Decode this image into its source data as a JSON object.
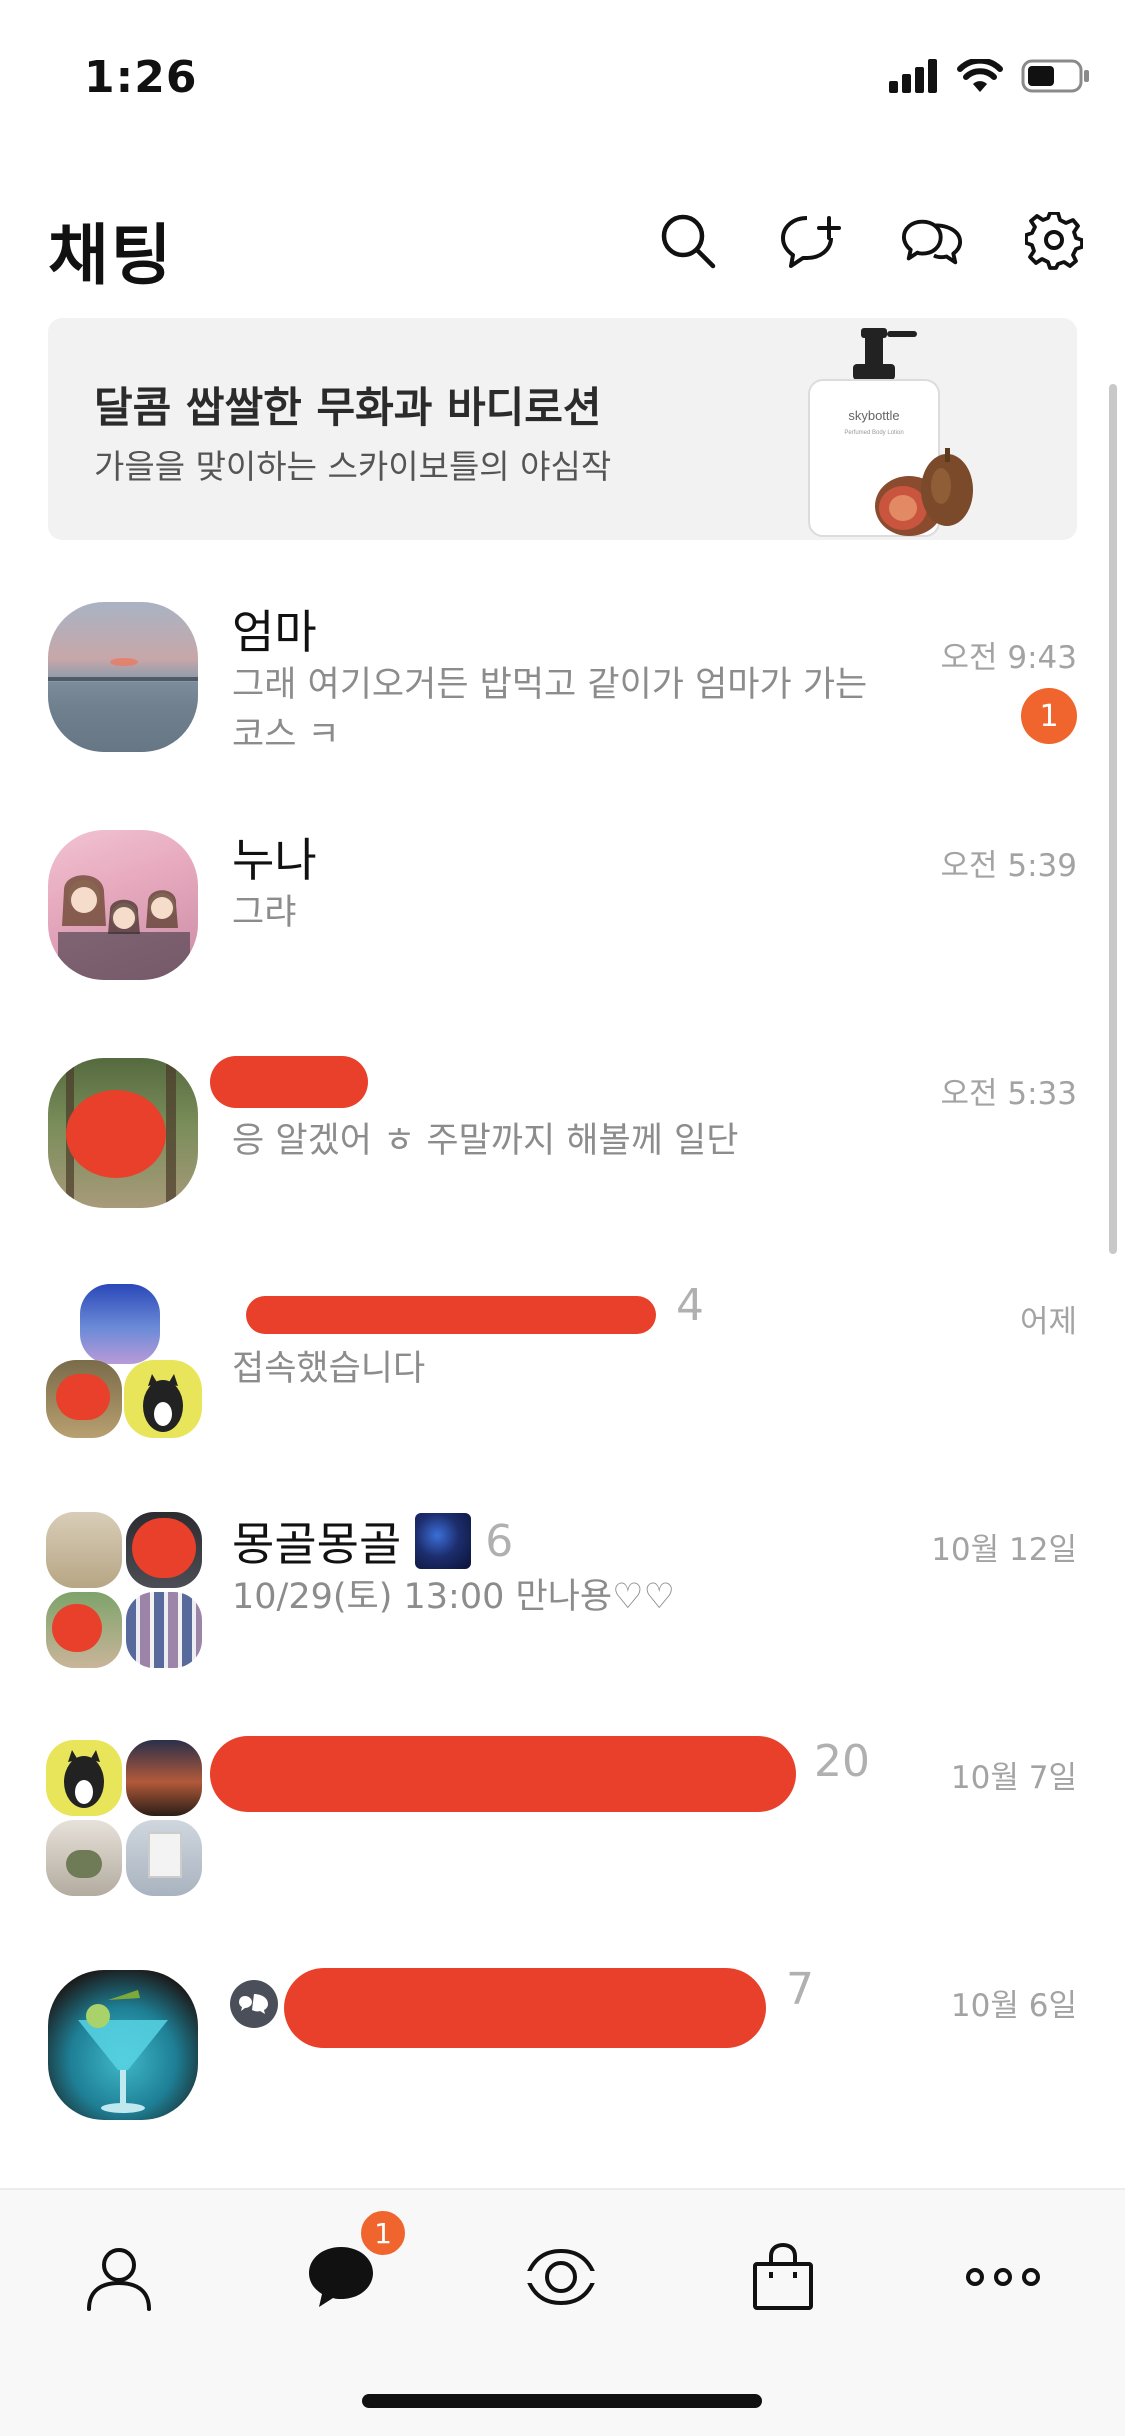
{
  "status_bar": {
    "time": "1:26"
  },
  "header": {
    "title": "채팅"
  },
  "ad": {
    "title": "달콤 쌉쌀한 무화과 바디로션",
    "subtitle": "가을을 맞이하는 스카이보틀의 야심작",
    "brand": "skybottle",
    "product": "Perfumed Body Lotion"
  },
  "chats": [
    {
      "name": "엄마",
      "preview": "그래 여기오거든 밥먹고 같이가 엄마가 가는코스 ㅋ",
      "time": "오전 9:43",
      "unread": "1"
    },
    {
      "name": "누나",
      "preview": "그랴",
      "time": "오전 5:39"
    },
    {
      "name": "",
      "preview": "응 알겠어 ㅎ 주말까지 해볼께 일단",
      "time": "오전 5:33"
    },
    {
      "name": "",
      "count": "4",
      "preview": "접속했습니다",
      "time": "어제"
    },
    {
      "name": "몽골몽골",
      "count": "6",
      "preview": "10/29(토) 13:00 만나용♡♡",
      "time": "10월 12일"
    },
    {
      "name": "",
      "count": "20",
      "preview": "",
      "time": "10월 7일"
    },
    {
      "name": "",
      "count": "7",
      "preview": "",
      "time": "10월 6일"
    }
  ],
  "tab_bar": {
    "chats_badge": "1"
  },
  "colors": {
    "accent": "#f0642d",
    "redaction": "#e8402a"
  }
}
